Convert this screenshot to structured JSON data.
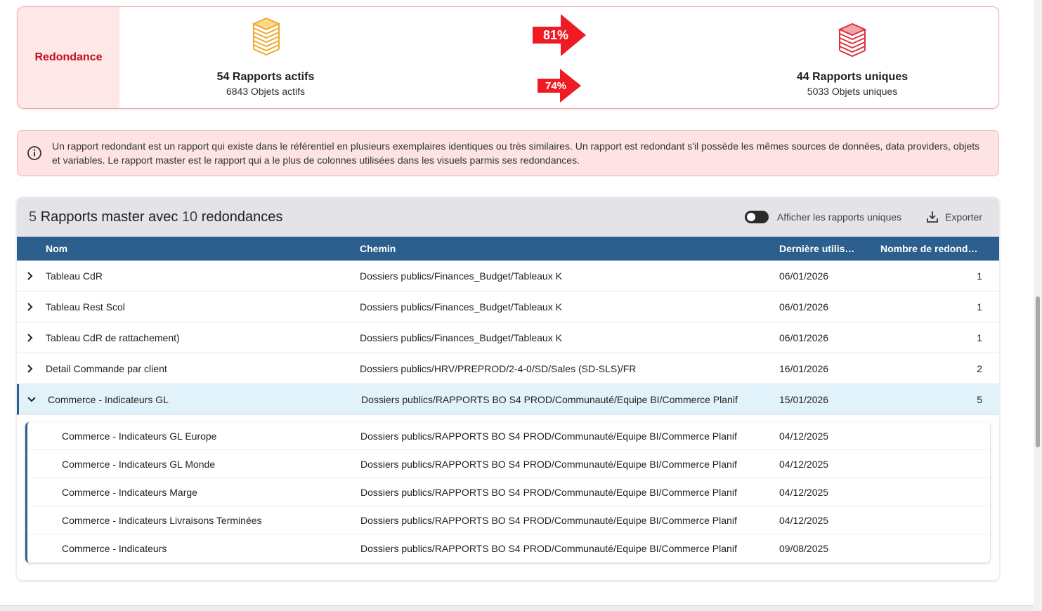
{
  "summary": {
    "label": "Redondance",
    "actifs": {
      "title": "54 Rapports actifs",
      "sub": "6843 Objets actifs"
    },
    "uniques": {
      "title": "44 Rapports uniques",
      "sub": "5033 Objets uniques"
    },
    "pct_rapports": "81%",
    "pct_objets": "74%",
    "colors": {
      "accent": "#c50f1f",
      "arrow": "#ee1b24",
      "stack_orange": "#f0a830",
      "stack_red": "#d9343f"
    }
  },
  "info": {
    "text": "Un rapport redondant est un rapport qui existe dans le référentiel en plusieurs exemplaires identiques ou très similaires. Un rapport est redondant s'il possède les mêmes sources de données, data providers, objets et variables. Le rapport master est le rapport qui a le plus de colonnes utilisées dans les visuels parmis ses redondances."
  },
  "table": {
    "title_count_master": "5",
    "title_mid": "Rapports master avec",
    "title_count_redond": "10",
    "title_end": "redondances",
    "toggle_label": "Afficher les rapports uniques",
    "export_label": "Exporter",
    "headers": {
      "nom": "Nom",
      "chemin": "Chemin",
      "date": "Dernière utilisat...",
      "nb": "Nombre de redondan..."
    },
    "rows": [
      {
        "nom": "Tableau CdR",
        "chemin": "Dossiers publics/Finances_Budget/Tableaux K",
        "date": "06/01/2026",
        "nb": "1"
      },
      {
        "nom": "Tableau Rest Scol",
        "chemin": "Dossiers publics/Finances_Budget/Tableaux K",
        "date": "06/01/2026",
        "nb": "1"
      },
      {
        "nom": "Tableau CdR de rattachement)",
        "chemin": "Dossiers publics/Finances_Budget/Tableaux K",
        "date": "06/01/2026",
        "nb": "1"
      },
      {
        "nom": "Detail Commande par client",
        "chemin": "Dossiers publics/HRV/PREPROD/2-4-0/SD/Sales (SD-SLS)/FR",
        "date": "16/01/2026",
        "nb": "2"
      },
      {
        "nom": "Commerce - Indicateurs GL",
        "chemin": "Dossiers publics/RAPPORTS BO S4 PROD/Communauté/Equipe BI/Commerce Planif",
        "date": "15/01/2026",
        "nb": "5"
      }
    ],
    "subrows": [
      {
        "nom": "Commerce - Indicateurs GL Europe",
        "chemin": "Dossiers publics/RAPPORTS BO S4 PROD/Communauté/Equipe BI/Commerce Planif",
        "date": "04/12/2025"
      },
      {
        "nom": "Commerce - Indicateurs GL Monde",
        "chemin": "Dossiers publics/RAPPORTS BO S4 PROD/Communauté/Equipe BI/Commerce Planif",
        "date": "04/12/2025"
      },
      {
        "nom": "Commerce - Indicateurs Marge",
        "chemin": "Dossiers publics/RAPPORTS BO S4 PROD/Communauté/Equipe BI/Commerce Planif",
        "date": "04/12/2025"
      },
      {
        "nom": "Commerce - Indicateurs Livraisons Terminées",
        "chemin": "Dossiers publics/RAPPORTS BO S4 PROD/Communauté/Equipe BI/Commerce Planif",
        "date": "04/12/2025"
      },
      {
        "nom": "Commerce - Indicateurs",
        "chemin": "Dossiers publics/RAPPORTS BO S4 PROD/Communauté/Equipe BI/Commerce Planif",
        "date": "09/08/2025"
      }
    ]
  }
}
